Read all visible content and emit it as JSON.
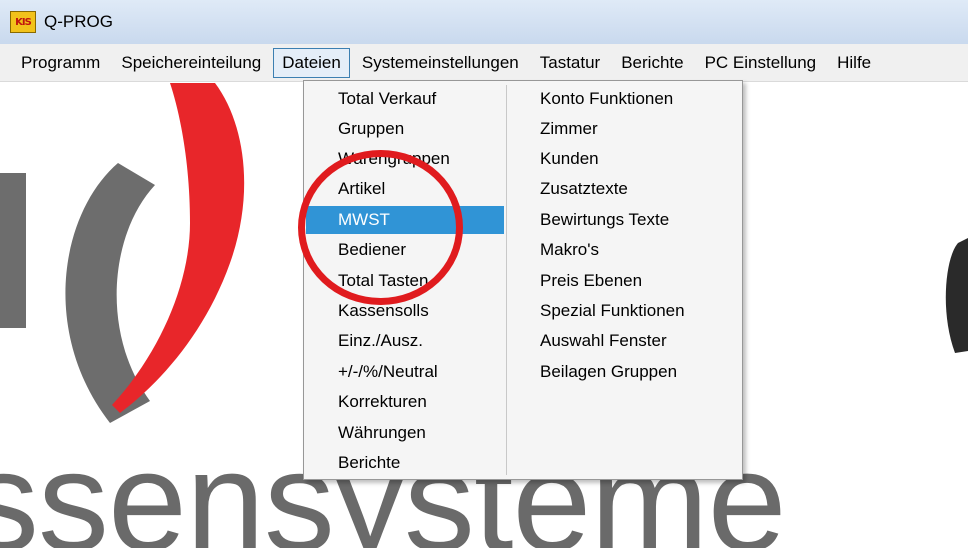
{
  "window": {
    "title": "Q-PROG",
    "icon": "qprog-app-icon",
    "icon_text": "KIS"
  },
  "menubar": {
    "items": [
      {
        "label": "Programm"
      },
      {
        "label": "Speichereinteilung"
      },
      {
        "label": "Dateien"
      },
      {
        "label": "Systemeinstellungen"
      },
      {
        "label": "Tastatur"
      },
      {
        "label": "Berichte"
      },
      {
        "label": "PC Einstellung"
      },
      {
        "label": "Hilfe"
      }
    ]
  },
  "background": {
    "logo_text": "ssensysteme",
    "logo_colors": {
      "red": "#e8262a",
      "gray": "#6d6d6d"
    }
  },
  "dropdown": {
    "column1": [
      "Total Verkauf",
      "Gruppen",
      "Warengruppen",
      "Artikel",
      "MWST",
      "Bediener",
      "Total Tasten",
      "Kassensolls",
      "Einz./Ausz.",
      "+/-/%/Neutral",
      "Korrekturen",
      "Währungen",
      "Berichte"
    ],
    "column2": [
      "Konto Funktionen",
      "Zimmer",
      "Kunden",
      "Zusatztexte",
      "Bewirtungs Texte",
      "Makro's",
      "Preis Ebenen",
      "Spezial Funktionen",
      "Auswahl Fenster",
      "Beilagen Gruppen"
    ],
    "selected": "MWST",
    "highlight_color": "#3094d6"
  },
  "annotation": {
    "circle_color": "#e01b1e"
  }
}
